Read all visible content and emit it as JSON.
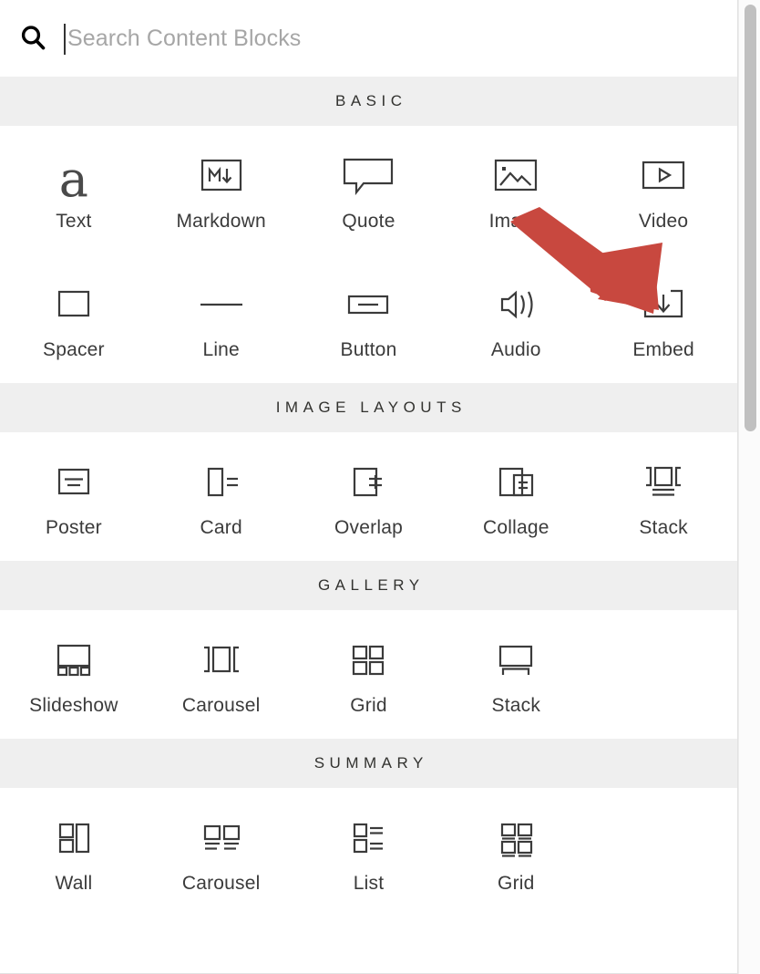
{
  "search": {
    "placeholder": "Search Content Blocks",
    "value": "",
    "icon": "search-icon"
  },
  "scrollbar": {
    "orientation": "vertical",
    "thumb_top_pct": 0,
    "thumb_height_pct": 44
  },
  "annotation": {
    "type": "arrow",
    "color": "#c8483f",
    "points_to": "Embed"
  },
  "sections": [
    {
      "title": "BASIC",
      "blocks": [
        {
          "label": "Text",
          "icon": "letter-a-icon"
        },
        {
          "label": "Markdown",
          "icon": "markdown-icon"
        },
        {
          "label": "Quote",
          "icon": "speech-bubble-icon"
        },
        {
          "label": "Image",
          "icon": "picture-icon"
        },
        {
          "label": "Video",
          "icon": "play-frame-icon"
        },
        {
          "label": "Spacer",
          "icon": "empty-square-icon"
        },
        {
          "label": "Line",
          "icon": "horizontal-line-icon"
        },
        {
          "label": "Button",
          "icon": "button-frame-icon"
        },
        {
          "label": "Audio",
          "icon": "speaker-waves-icon"
        },
        {
          "label": "Embed",
          "icon": "download-bracket-icon"
        }
      ]
    },
    {
      "title": "IMAGE LAYOUTS",
      "blocks": [
        {
          "label": "Poster",
          "icon": "poster-icon"
        },
        {
          "label": "Card",
          "icon": "card-icon"
        },
        {
          "label": "Overlap",
          "icon": "overlap-icon"
        },
        {
          "label": "Collage",
          "icon": "collage-icon"
        },
        {
          "label": "Stack",
          "icon": "stack-brackets-icon"
        }
      ]
    },
    {
      "title": "GALLERY",
      "blocks": [
        {
          "label": "Slideshow",
          "icon": "slideshow-icon"
        },
        {
          "label": "Carousel",
          "icon": "carousel-brackets-icon"
        },
        {
          "label": "Grid",
          "icon": "grid-four-icon"
        },
        {
          "label": "Stack",
          "icon": "gallery-stack-icon"
        }
      ]
    },
    {
      "title": "SUMMARY",
      "blocks": [
        {
          "label": "Wall",
          "icon": "wall-icon"
        },
        {
          "label": "Carousel",
          "icon": "summary-carousel-icon"
        },
        {
          "label": "List",
          "icon": "summary-list-icon"
        },
        {
          "label": "Grid",
          "icon": "summary-grid-icon"
        }
      ]
    }
  ]
}
